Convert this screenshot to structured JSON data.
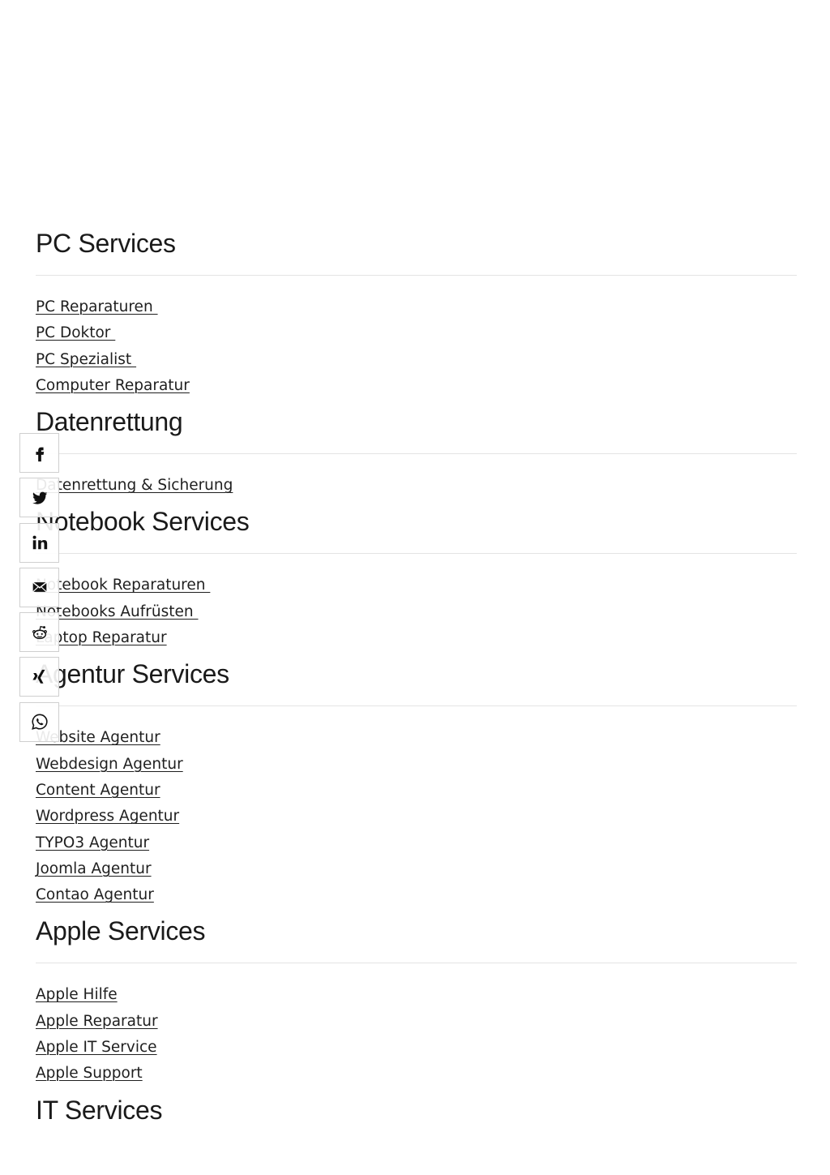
{
  "sections": [
    {
      "title": "PC Services",
      "links": [
        "PC Reparaturen ",
        "PC Doktor ",
        "PC Spezialist ",
        "Computer Reparatur"
      ]
    },
    {
      "title": "Datenrettung",
      "links": [
        "Datenrettung & Sicherung"
      ]
    },
    {
      "title": "Notebook Services",
      "links": [
        "Notebook Reparaturen ",
        "Notebooks Aufrüsten ",
        "Laptop Reparatur"
      ]
    },
    {
      "title": "Agentur Services",
      "links": [
        "Website Agentur",
        "Webdesign Agentur",
        "Content Agentur",
        "Wordpress Agentur",
        "TYPO3 Agentur",
        "Joomla Agentur",
        "Contao Agentur"
      ]
    },
    {
      "title": "Apple Services",
      "links": [
        "Apple Hilfe",
        "Apple Reparatur",
        "Apple IT Service",
        "Apple Support"
      ]
    },
    {
      "title": "IT Services",
      "links": []
    }
  ],
  "share_bar": {
    "buttons": [
      {
        "icon": "facebook-icon"
      },
      {
        "icon": "twitter-icon"
      },
      {
        "icon": "linkedin-icon"
      },
      {
        "icon": "email-icon"
      },
      {
        "icon": "reddit-icon"
      },
      {
        "icon": "xing-icon"
      },
      {
        "icon": "whatsapp-icon"
      }
    ]
  },
  "colors": {
    "text": "#1a1a1a",
    "divider": "#e4e4e4",
    "share_border": "#cfcfcf"
  }
}
